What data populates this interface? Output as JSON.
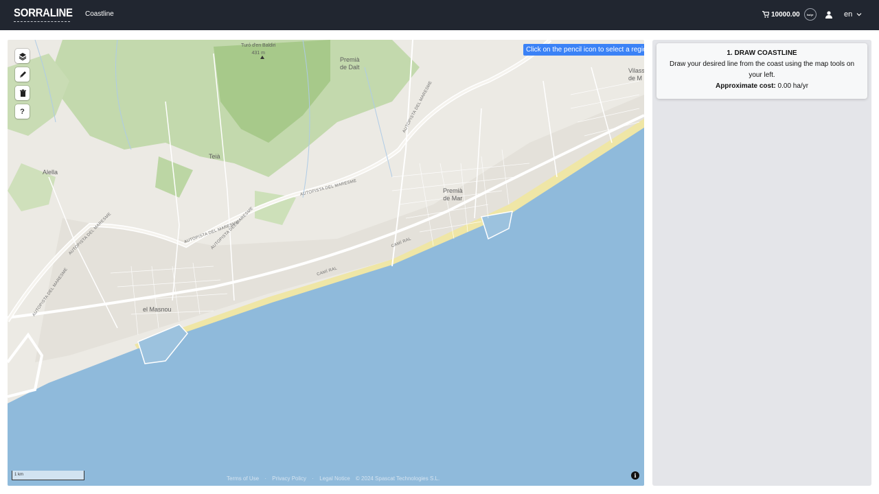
{
  "header": {
    "logo_text": "SORRALINE",
    "nav_link": "Coastline",
    "cart_amount": "10000.00",
    "cart_unit": "ha/yr",
    "language": "en"
  },
  "map": {
    "hint": "Click on the pencil icon to select a region",
    "peak_name": "Turó d'en Baldiri",
    "peak_elevation": "431 m",
    "places": {
      "premia_dalt_1": "Premià",
      "premia_dalt_2": "de Dalt",
      "premia_mar_1": "Premià",
      "premia_mar_2": "de Mar",
      "teia": "Teià",
      "alella": "Alella",
      "el_masnou": "el Masnou",
      "vilassar_1": "Vilass",
      "vilassar_2": "de M"
    },
    "roads": {
      "autopista_1": "AUTOPISTA DEL MARESME",
      "autopista_2": "AUTOPISTA DEL MARESME",
      "autopista_3": "AUTOPISTA DEL MARESME",
      "autopista_4": "AUTOPISTA DEL MARESME",
      "autopista_5": "AUTOPISTA DEL MARESME",
      "autopista_6": "AUTOPISTA DEL MARESME",
      "cami_ral_1": "CAMÍ RAL",
      "cami_ral_2": "CAMÍ RAL"
    },
    "tools": {
      "layers": "layers-icon",
      "pencil": "pencil-icon",
      "delete": "trash-icon",
      "help": "?"
    },
    "scale_label": "1 km",
    "footer": {
      "terms": "Terms of Use",
      "sep": "·",
      "privacy": "Privacy Policy",
      "legal": "Legal Notice",
      "copyright": "© 2024 Spascat Technologies S.L."
    },
    "info_label": "i",
    "colors": {
      "sea": "#8fbadb",
      "land": "#ecebe5",
      "green": "#b7d5a0",
      "road": "#ffffff",
      "beach": "#efe6a6"
    }
  },
  "panel": {
    "title": "1. DRAW COASTLINE",
    "instructions": "Draw your desired line from the coast using the map tools on your left.",
    "cost_label": "Approximate cost:",
    "cost_value": "0.00 ha/yr"
  }
}
